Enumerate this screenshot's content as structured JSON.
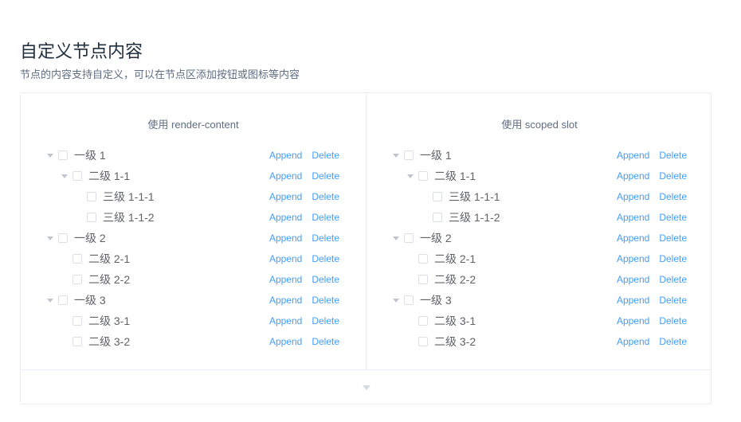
{
  "page": {
    "title": "自定义节点内容",
    "description": "节点的内容支持自定义，可以在节点区添加按钮或图标等内容"
  },
  "left_panel": {
    "title": "使用 render-content",
    "nodes": [
      {
        "label": "一级 1",
        "level": 1,
        "expandable": true
      },
      {
        "label": "二级 1-1",
        "level": 2,
        "expandable": true
      },
      {
        "label": "三级 1-1-1",
        "level": 3,
        "expandable": false
      },
      {
        "label": "三级 1-1-2",
        "level": 3,
        "expandable": false
      },
      {
        "label": "一级 2",
        "level": 1,
        "expandable": true
      },
      {
        "label": "二级 2-1",
        "level": 2,
        "expandable": false
      },
      {
        "label": "二级 2-2",
        "level": 2,
        "expandable": false
      },
      {
        "label": "一级 3",
        "level": 1,
        "expandable": true
      },
      {
        "label": "二级 3-1",
        "level": 2,
        "expandable": false
      },
      {
        "label": "二级 3-2",
        "level": 2,
        "expandable": false
      }
    ]
  },
  "right_panel": {
    "title": "使用 scoped slot",
    "nodes": [
      {
        "label": "一级 1",
        "level": 1,
        "expandable": true
      },
      {
        "label": "二级 1-1",
        "level": 2,
        "expandable": true
      },
      {
        "label": "三级 1-1-1",
        "level": 3,
        "expandable": false
      },
      {
        "label": "三级 1-1-2",
        "level": 3,
        "expandable": false
      },
      {
        "label": "一级 2",
        "level": 1,
        "expandable": true
      },
      {
        "label": "二级 2-1",
        "level": 2,
        "expandable": false
      },
      {
        "label": "二级 2-2",
        "level": 2,
        "expandable": false
      },
      {
        "label": "一级 3",
        "level": 1,
        "expandable": true
      },
      {
        "label": "二级 3-1",
        "level": 2,
        "expandable": false
      },
      {
        "label": "二级 3-2",
        "level": 2,
        "expandable": false
      }
    ]
  },
  "actions": {
    "append_label": "Append",
    "delete_label": "Delete"
  },
  "colors": {
    "link": "#409eff",
    "text": "#606266",
    "border": "#ebebeb"
  }
}
